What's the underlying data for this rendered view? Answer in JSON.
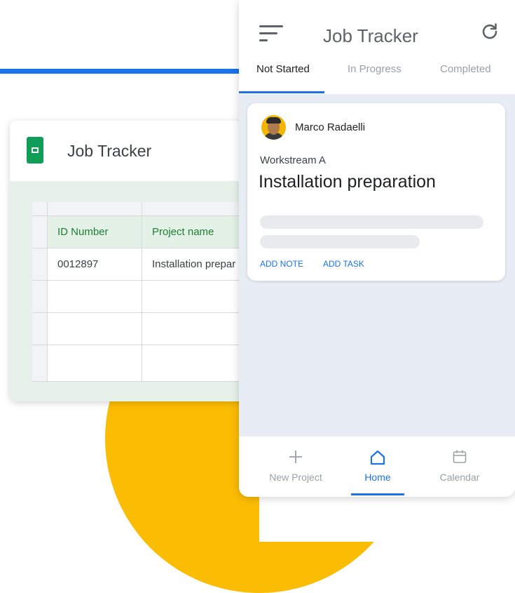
{
  "sheet": {
    "title": "Job Tracker",
    "headers": [
      "ID Number",
      "Project name"
    ],
    "rows": [
      [
        "0012897",
        "Installation prepar"
      ]
    ]
  },
  "app": {
    "title": "Job Tracker",
    "tabs": [
      {
        "label": "Not Started",
        "active": true
      },
      {
        "label": "In Progress",
        "active": false
      },
      {
        "label": "Completed",
        "active": false
      }
    ],
    "card": {
      "owner": "Marco Radaelli",
      "workstream": "Workstream A",
      "title": "Installation preparation",
      "actions": [
        "ADD NOTE",
        "ADD TASK"
      ]
    },
    "nav": [
      {
        "label": "New Project",
        "icon": "plus-icon",
        "active": false
      },
      {
        "label": "Home",
        "icon": "home-icon",
        "active": true
      },
      {
        "label": "Calendar",
        "icon": "calendar-icon",
        "active": false
      }
    ]
  },
  "colors": {
    "accent_blue": "#1a73e8",
    "sheets_green": "#0f9d58",
    "yellow": "#fbbc04",
    "inactive_gray": "#9aa0a6"
  }
}
